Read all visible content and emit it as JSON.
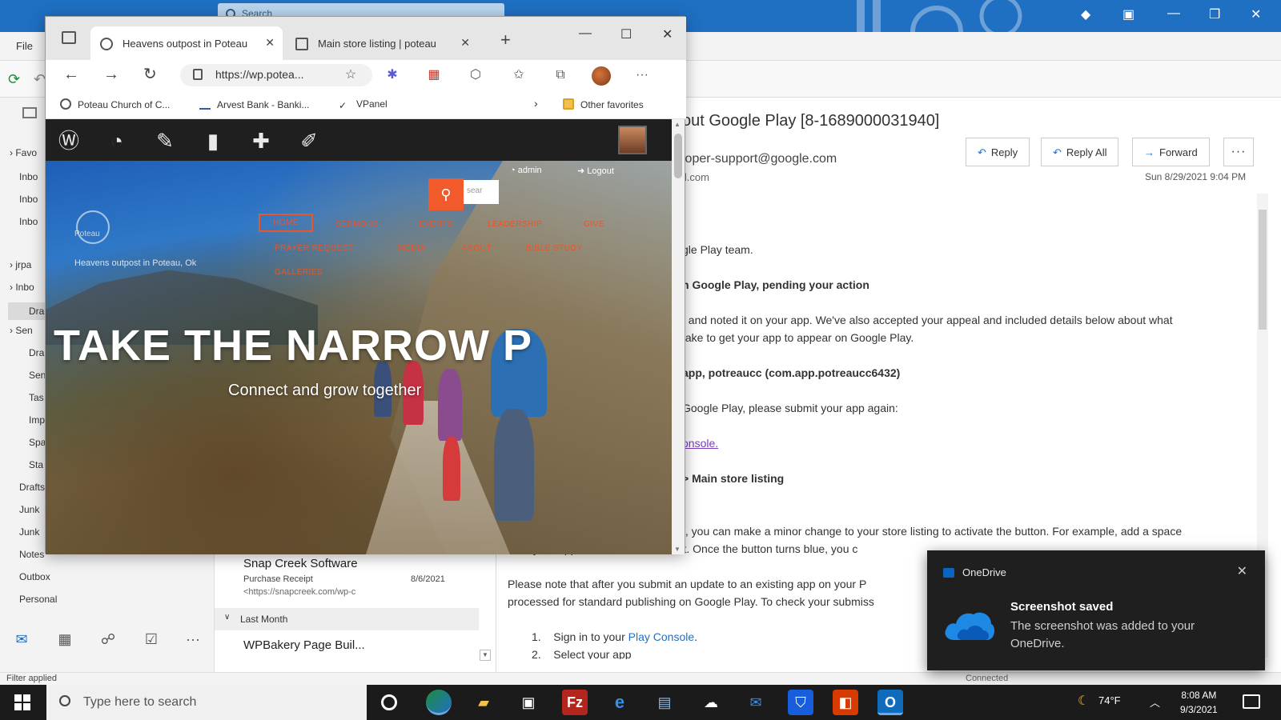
{
  "outlook": {
    "search_placeholder": "Search",
    "menu_file": "File",
    "folders": {
      "fav_header": "Favo",
      "inbox1": "Inbo",
      "inbox2": "Inbo",
      "inbox3": "Inbo",
      "acct_header": "jrpa",
      "inbox4": "Inbo",
      "drafts": "Dra",
      "sec_header": "Sen",
      "i1": "Dra",
      "i2": "Sen",
      "i3": "Tas",
      "i4": "Imp",
      "i5": "Spa",
      "i6": "Sta",
      "drafts2": "Drafts",
      "junk1": "Junk",
      "junk2": "Junk",
      "notes": "Notes",
      "outbox": "Outbox",
      "personal": "Personal"
    },
    "messages": [
      {
        "sender": "Snap Creek Software",
        "subject": "Purchase Receipt",
        "preview": "<https://snapcreek.com/wp-c",
        "date": "8/6/2021"
      }
    ],
    "group_last_month": "Last Month",
    "message2_sender": "WPBakery Page Buil...",
    "reading": {
      "subject": "out Google Play [8-1689000031940]",
      "from": "loper-support@google.com",
      "to": "il.com",
      "date": "Sun 8/29/2021 9:04 PM",
      "reply": "Reply",
      "reply_all": "Reply All",
      "forward": "Forward",
      "more": "···",
      "line1": "gle Play team.",
      "line2": "n Google Play, pending your action",
      "line3": "t and noted it on your app. We've also accepted your appeal and included details below about what",
      "line4": "take to get your app  to appear on Google Play.",
      "line5": "app, potreaucc (com.app.potreaucc6432)",
      "line6": "Google Play, please submit your app again:",
      "line7": "onsole.",
      "line8_prefix": "> ",
      "line8": "Main store listing",
      "line9": "t, you can make a minor change to your store listing to activate the button. For example, add a space",
      "line10": "after your app title and then delete it. Once the button turns blue, you c",
      "line11": "Please note that after you submit an update to an existing app on your P",
      "line12": "processed for standard publishing on Google Play. To check your submiss",
      "step1_num": "1.",
      "step1": "Sign in to your ",
      "step1_link": "Play Console",
      "step1_end": ".",
      "step2_num": "2.",
      "step2": "Select your app"
    },
    "status_filter": "Filter applied",
    "status_connected": "Connected"
  },
  "edge": {
    "tab1_title": "Heavens outpost in Poteau",
    "tab2_title": "Main store listing | poteau",
    "url": "https://wp.potea...",
    "favorites": [
      {
        "label": "Poteau Church of C..."
      },
      {
        "label": "Arvest Bank - Banki..."
      },
      {
        "label": "VPanel"
      }
    ],
    "other_favorites": "Other favorites"
  },
  "site": {
    "logo_text": "Poteau",
    "tagline": "Heavens outpost in Poteau, Ok",
    "search_placeholder": "sear",
    "admin": "admin",
    "logout": "Logout",
    "menu": {
      "home": "HOME",
      "sermons": "SERMONS",
      "events": "EVENTS",
      "leadership": "LEADERSHIP",
      "give": "GIVE",
      "prayer": "PRAYER REQUEST",
      "media": "MEDIA",
      "contact": "ABOUT",
      "bible": "BIBLE STUDY",
      "galleries": "GALLERIES"
    },
    "hero_title": "TAKE THE NARROW P",
    "hero_sub": "Connect and grow together"
  },
  "toast": {
    "app": "OneDrive",
    "title": "Screenshot saved",
    "body": "The screenshot was added to your OneDrive."
  },
  "taskbar": {
    "search_placeholder": "Type here to search",
    "temperature": "74°F",
    "time": "8:08 AM",
    "date": "9/3/2021"
  }
}
